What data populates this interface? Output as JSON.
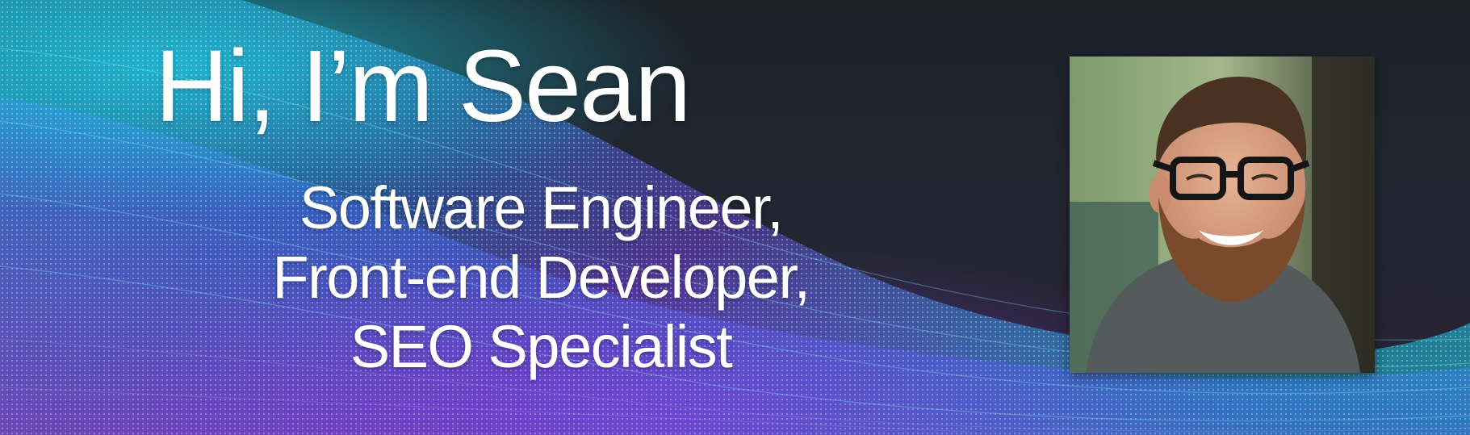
{
  "banner": {
    "headline": "Hi, I’m Sean",
    "roles": [
      "Software Engineer,",
      "Front-end Developer,",
      "SEO Specialist"
    ]
  },
  "colors": {
    "background": "#222630",
    "wave_cyan": "#19c9e6",
    "wave_blue": "#2a7be0",
    "wave_purple": "#6a3fd1",
    "wave_magenta": "#a13bd3",
    "text": "#ffffff"
  },
  "photo": {
    "subject": "smiling-man-with-glasses-and-beard-icon"
  }
}
